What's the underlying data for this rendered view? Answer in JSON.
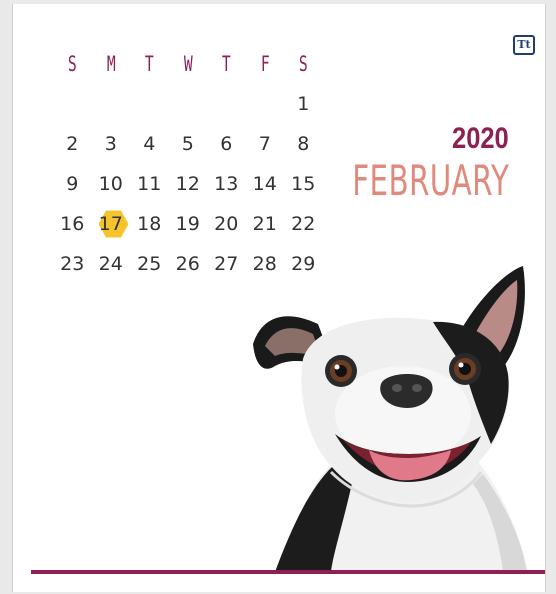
{
  "brand": {
    "logo_text": "Tt"
  },
  "calendar": {
    "year": "2020",
    "month": "FEBRUARY",
    "weekdays": [
      "S",
      "M",
      "T",
      "W",
      "T",
      "F",
      "S"
    ],
    "weeks": [
      [
        "",
        "",
        "",
        "",
        "",
        "",
        "1"
      ],
      [
        "2",
        "3",
        "4",
        "5",
        "6",
        "7",
        "8"
      ],
      [
        "9",
        "10",
        "11",
        "12",
        "13",
        "14",
        "15"
      ],
      [
        "16",
        "17",
        "18",
        "19",
        "20",
        "21",
        "22"
      ],
      [
        "23",
        "24",
        "25",
        "26",
        "27",
        "28",
        "29"
      ]
    ],
    "highlighted_day": "17"
  },
  "colors": {
    "accent": "#8d2153",
    "month_text": "#e08a7c",
    "highlight": "#f5c42c"
  },
  "illustration": {
    "icon": "boston-terrier-dog-illustration"
  }
}
